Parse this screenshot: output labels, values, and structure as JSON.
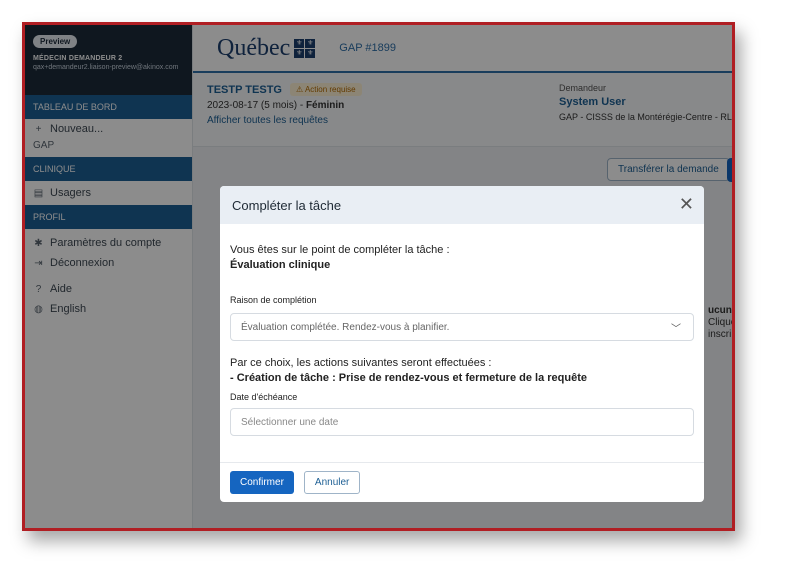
{
  "sidebar": {
    "badge": "Preview",
    "user": "MÉDECIN DEMANDEUR 2",
    "email": "qax+demandeur2.liaison-preview@akinox.com",
    "section_dashboard": "TABLEAU DE BORD",
    "new_item": "Nouveau...",
    "gap_label": "GAP",
    "section_clinic": "CLINIQUE",
    "users_item": "Usagers",
    "section_profile": "PROFIL",
    "account_item": "Paramètres du compte",
    "logout_item": "Déconnexion",
    "help_item": "Aide",
    "english_item": "English"
  },
  "header": {
    "logo_text": "Québec",
    "gap_number": "GAP #1899"
  },
  "patient": {
    "name": "TESTP TESTG",
    "warning": "Action requise",
    "dob": "2023-08-17 (5 mois) - ",
    "sex": "Féminin",
    "link": "Afficher toutes les requêtes"
  },
  "requester": {
    "label": "Demandeur",
    "name": "System User",
    "org": "GAP - CISSS de la Montérégie-Centre - RLS"
  },
  "actions": {
    "transfer": "Transférer la demande"
  },
  "bg_fragment": {
    "line1": "ucune",
    "line2": "Cliquez",
    "line3": "inscrire"
  },
  "modal": {
    "title": "Compléter la tâche",
    "intro": "Vous êtes sur le point de compléter la tâche :",
    "task": "Évaluation clinique",
    "reason_label": "Raison de complétion",
    "reason_value": "Évaluation complétée. Rendez-vous à planifier.",
    "consequence": "Par ce choix, les actions suivantes seront effectuées :",
    "action_line": "- Création de tâche : Prise de rendez-vous et fermeture de la requête",
    "due_label": "Date d'échéance",
    "due_placeholder": "Sélectionner une date",
    "confirm": "Confirmer",
    "cancel": "Annuler"
  }
}
